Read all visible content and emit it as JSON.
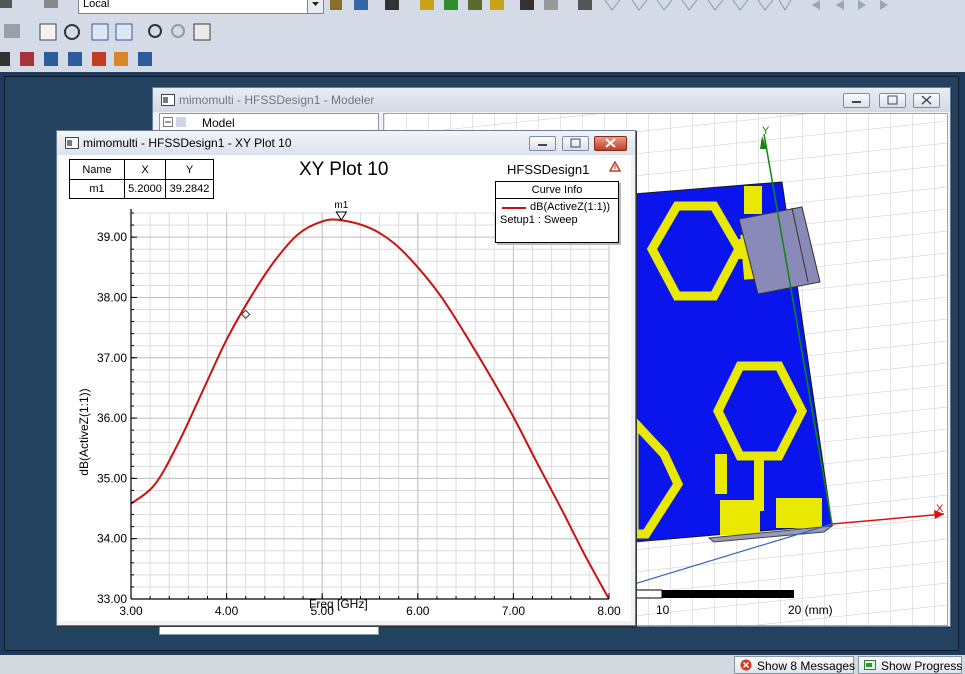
{
  "toolbar": {
    "coordinate_system": "Local"
  },
  "modeler": {
    "title": "mimomulti - HFSSDesign1 - Modeler",
    "tree_root": "Model",
    "ruler_labels": [
      "10",
      "20 (mm)"
    ],
    "axis_x": "X",
    "axis_y": "Y"
  },
  "plot_window": {
    "title": "mimomulti - HFSSDesign1 - XY Plot 10",
    "plot_title": "XY Plot 10",
    "design_name": "HFSSDesign1",
    "marker_table": {
      "headers": [
        "Name",
        "X",
        "Y"
      ],
      "rows": [
        [
          "m1",
          "5.2000",
          "39.2842"
        ]
      ]
    },
    "marker_label": "m1",
    "curve_info": {
      "title": "Curve Info",
      "curve_name": "dB(ActiveZ(1:1))",
      "setup": "Setup1 : Sweep"
    }
  },
  "chart_data": {
    "type": "line",
    "xlabel": "Freq [GHz]",
    "ylabel": "dB(ActiveZ(1:1))",
    "xlim": [
      3.0,
      8.0
    ],
    "ylim": [
      33.0,
      39.4
    ],
    "x_ticks": [
      "3.00",
      "4.00",
      "5.00",
      "6.00",
      "7.00",
      "8.00"
    ],
    "y_ticks": [
      "33.00",
      "34.00",
      "35.00",
      "36.00",
      "37.00",
      "38.00",
      "39.00"
    ],
    "grid": true,
    "series": [
      {
        "name": "dB(ActiveZ(1:1))",
        "color": "#cc1111",
        "x": [
          3.0,
          3.25,
          3.5,
          3.75,
          4.0,
          4.25,
          4.5,
          4.75,
          5.0,
          5.2,
          5.5,
          5.75,
          6.0,
          6.25,
          6.5,
          6.75,
          7.0,
          7.25,
          7.5,
          7.75,
          8.0
        ],
        "y": [
          34.58,
          34.9,
          35.6,
          36.45,
          37.3,
          38.0,
          38.6,
          39.05,
          39.26,
          39.28,
          39.15,
          38.9,
          38.5,
          38.0,
          37.38,
          36.72,
          36.02,
          35.25,
          34.5,
          33.72,
          33.0
        ]
      }
    ],
    "markers": [
      {
        "name": "m1",
        "x": 5.2,
        "y": 39.2842
      }
    ]
  },
  "statusbar": {
    "messages_label": "Show 8 Messages",
    "progress_label": "Show Progress"
  }
}
